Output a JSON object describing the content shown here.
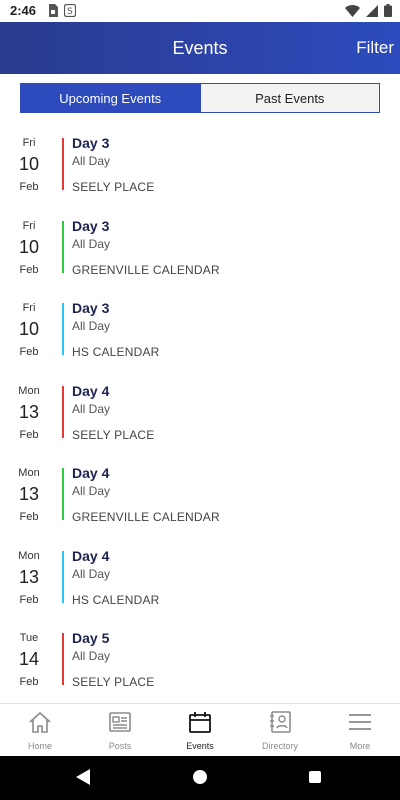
{
  "status": {
    "time": "2:46"
  },
  "header": {
    "title": "Events",
    "filter_label": "Filter"
  },
  "tabs": {
    "upcoming": "Upcoming Events",
    "past": "Past Events"
  },
  "events": [
    {
      "dow": "Fri",
      "day": "10",
      "month": "Feb",
      "title": "Day 3",
      "time": "All Day",
      "calendar": "SEELY PLACE",
      "color": "#e53935"
    },
    {
      "dow": "Fri",
      "day": "10",
      "month": "Feb",
      "title": "Day 3",
      "time": "All Day",
      "calendar": "GREENVILLE CALENDAR",
      "color": "#2ecc40"
    },
    {
      "dow": "Fri",
      "day": "10",
      "month": "Feb",
      "title": "Day 3",
      "time": "All Day",
      "calendar": "HS CALENDAR",
      "color": "#29c5f6"
    },
    {
      "dow": "Mon",
      "day": "13",
      "month": "Feb",
      "title": "Day 4",
      "time": "All Day",
      "calendar": "SEELY PLACE",
      "color": "#e53935"
    },
    {
      "dow": "Mon",
      "day": "13",
      "month": "Feb",
      "title": "Day 4",
      "time": "All Day",
      "calendar": "GREENVILLE CALENDAR",
      "color": "#2ecc40"
    },
    {
      "dow": "Mon",
      "day": "13",
      "month": "Feb",
      "title": "Day 4",
      "time": "All Day",
      "calendar": "HS CALENDAR",
      "color": "#29c5f6"
    },
    {
      "dow": "Tue",
      "day": "14",
      "month": "Feb",
      "title": "Day 5",
      "time": "All Day",
      "calendar": "SEELY PLACE",
      "color": "#e53935"
    }
  ],
  "bottom_nav": [
    {
      "label": "Home",
      "icon": "home-icon"
    },
    {
      "label": "Posts",
      "icon": "posts-icon"
    },
    {
      "label": "Events",
      "icon": "calendar-icon",
      "active": true
    },
    {
      "label": "Directory",
      "icon": "directory-icon"
    },
    {
      "label": "More",
      "icon": "menu-icon"
    }
  ]
}
